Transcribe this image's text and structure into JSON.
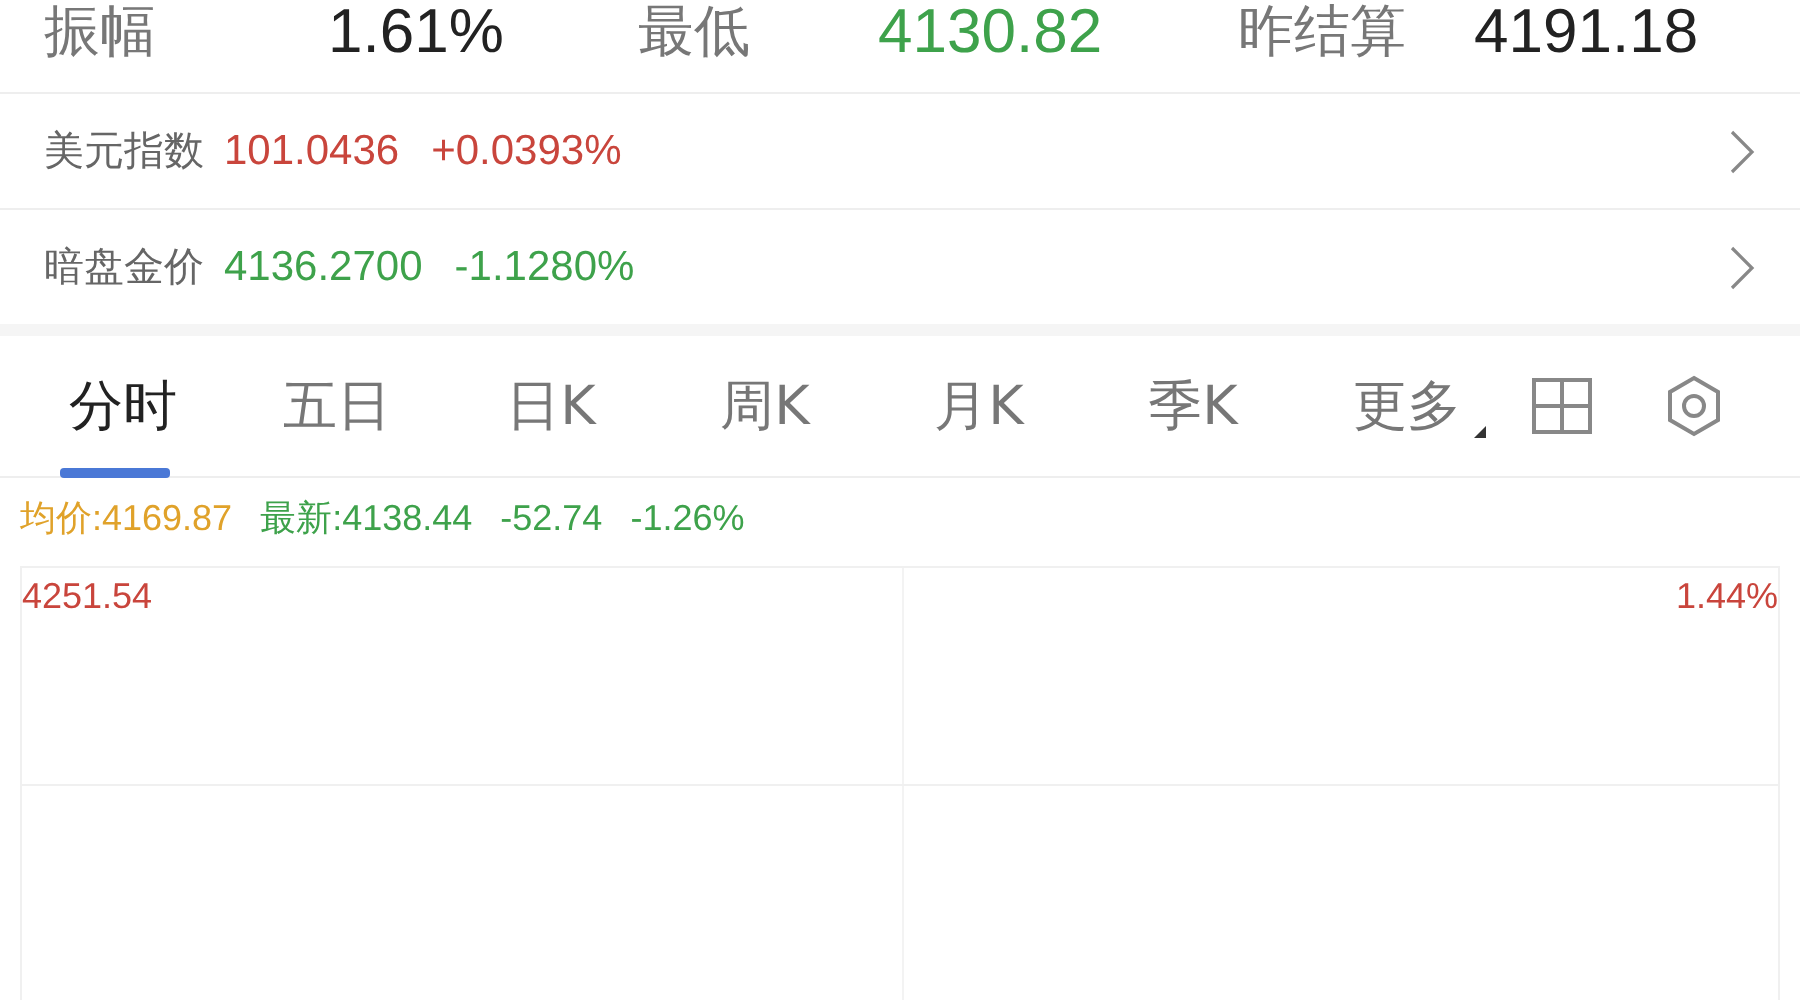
{
  "summary": [
    {
      "label": "振幅",
      "value": "1.61%",
      "color": "#222222"
    },
    {
      "label": "最低",
      "value": "4130.82",
      "color": "#3ea24b"
    },
    {
      "label": "昨结算",
      "value": "4191.18",
      "color": "#222222"
    }
  ],
  "quotes": [
    {
      "name": "美元指数",
      "price": "101.0436",
      "change": "+0.0393%",
      "color": "#c9453c"
    },
    {
      "name": "暗盘金价",
      "price": "4136.2700",
      "change": "-1.1280%",
      "color": "#3ea24b"
    }
  ],
  "tabs": [
    {
      "label": "分时",
      "selected": true,
      "kind": "plain"
    },
    {
      "label": "五日",
      "selected": false,
      "kind": "plain"
    },
    {
      "label": "日K",
      "selected": false,
      "kind": "plain"
    },
    {
      "label": "周K",
      "selected": false,
      "kind": "plain"
    },
    {
      "label": "月K",
      "selected": false,
      "kind": "plain"
    },
    {
      "label": "季K",
      "selected": false,
      "kind": "plain"
    },
    {
      "label": "更多",
      "selected": false,
      "kind": "menu"
    }
  ],
  "info": [
    {
      "text": "均价:4169.87",
      "color": "#e0a22a"
    },
    {
      "text": "最新:4138.44",
      "color": "#3ea24b"
    },
    {
      "text": "-52.74",
      "color": "#3ea24b"
    },
    {
      "text": "-1.26%",
      "color": "#3ea24b"
    }
  ],
  "chart": {
    "high_price": "4251.54",
    "high_percent": "1.44%"
  }
}
